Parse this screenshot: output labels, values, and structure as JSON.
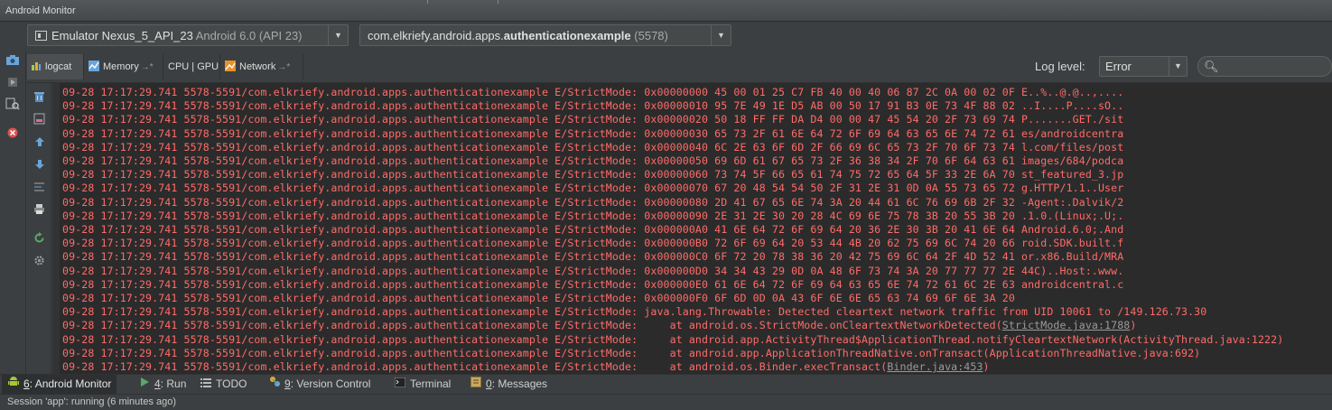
{
  "window": {
    "title": "Android Monitor"
  },
  "devices": {
    "device_name": "Emulator Nexus_5_API_23",
    "device_version": "Android 6.0 (API 23)",
    "process_name": "com.elkriefy.android.apps.",
    "process_bold": "authenticationexample",
    "process_pid": "(5578)"
  },
  "tabs": [
    {
      "label": "logcat"
    },
    {
      "label": "Memory"
    },
    {
      "label": "CPU | GPU"
    },
    {
      "label": "Network"
    }
  ],
  "log_level": {
    "label": "Log level:",
    "value": "Error"
  },
  "log_prefix": "09-28 17:17:29.741 5578-5591/com.elkriefy.android.apps.authenticationexample E/StrictMode: ",
  "log_lines": [
    {
      "text": "0x00000000 45 00 01 25 C7 FB 40 00 40 06 87 2C 0A 00 02 0F E..%..@.@..,....",
      "link": "",
      "tail": ""
    },
    {
      "text": "0x00000010 95 7E 49 1E D5 AB 00 50 17 91 B3 0E 73 4F 88 02 ..I....P....sO..",
      "link": "",
      "tail": ""
    },
    {
      "text": "0x00000020 50 18 FF FF DA D4 00 00 47 45 54 20 2F 73 69 74 P.......GET./sit",
      "link": "",
      "tail": ""
    },
    {
      "text": "0x00000030 65 73 2F 61 6E 64 72 6F 69 64 63 65 6E 74 72 61 es/androidcentra",
      "link": "",
      "tail": ""
    },
    {
      "text": "0x00000040 6C 2E 63 6F 6D 2F 66 69 6C 65 73 2F 70 6F 73 74 l.com/files/post",
      "link": "",
      "tail": ""
    },
    {
      "text": "0x00000050 69 6D 61 67 65 73 2F 36 38 34 2F 70 6F 64 63 61 images/684/podca",
      "link": "",
      "tail": ""
    },
    {
      "text": "0x00000060 73 74 5F 66 65 61 74 75 72 65 64 5F 33 2E 6A 70 st_featured_3.jp",
      "link": "",
      "tail": ""
    },
    {
      "text": "0x00000070 67 20 48 54 54 50 2F 31 2E 31 0D 0A 55 73 65 72 g.HTTP/1.1..User",
      "link": "",
      "tail": ""
    },
    {
      "text": "0x00000080 2D 41 67 65 6E 74 3A 20 44 61 6C 76 69 6B 2F 32 -Agent:.Dalvik/2",
      "link": "",
      "tail": ""
    },
    {
      "text": "0x00000090 2E 31 2E 30 20 28 4C 69 6E 75 78 3B 20 55 3B 20 .1.0.(Linux;.U;.",
      "link": "",
      "tail": ""
    },
    {
      "text": "0x000000A0 41 6E 64 72 6F 69 64 20 36 2E 30 3B 20 41 6E 64 Android.6.0;.And",
      "link": "",
      "tail": ""
    },
    {
      "text": "0x000000B0 72 6F 69 64 20 53 44 4B 20 62 75 69 6C 74 20 66 roid.SDK.built.f",
      "link": "",
      "tail": ""
    },
    {
      "text": "0x000000C0 6F 72 20 78 38 36 20 42 75 69 6C 64 2F 4D 52 41 or.x86.Build/MRA",
      "link": "",
      "tail": ""
    },
    {
      "text": "0x000000D0 34 34 43 29 0D 0A 48 6F 73 74 3A 20 77 77 77 2E 44C)..Host:.www.",
      "link": "",
      "tail": ""
    },
    {
      "text": "0x000000E0 61 6E 64 72 6F 69 64 63 65 6E 74 72 61 6C 2E 63 androidcentral.c",
      "link": "",
      "tail": ""
    },
    {
      "text": "0x000000F0 6F 6D 0D 0A 43 6F 6E 6E 65 63 74 69 6F 6E 3A 20",
      "link": "",
      "tail": ""
    },
    {
      "text": "java.lang.Throwable: Detected cleartext network traffic from UID 10061 to /149.126.73.30",
      "link": "",
      "tail": ""
    },
    {
      "text": "    at android.os.StrictMode.onCleartextNetworkDetected(",
      "link": "StrictMode.java:1788",
      "tail": ")"
    },
    {
      "text": "    at android.app.ActivityThread$ApplicationThread.notifyCleartextNetwork(ActivityThread.java:1222)",
      "link": "",
      "tail": ""
    },
    {
      "text": "    at android.app.ApplicationThreadNative.onTransact(ApplicationThreadNative.java:692)",
      "link": "",
      "tail": ""
    },
    {
      "text": "    at android.os.Binder.execTransact(",
      "link": "Binder.java:453",
      "tail": ")"
    }
  ],
  "bottom_tabs": [
    {
      "num": "6",
      "label": ": Android Monitor"
    },
    {
      "num": "4",
      "label": ": Run"
    },
    {
      "num": "",
      "label": "TODO"
    },
    {
      "num": "9",
      "label": ": Version Control"
    },
    {
      "num": "",
      "label": "Terminal"
    },
    {
      "num": "0",
      "label": ": Messages"
    }
  ],
  "status": {
    "text": "Session 'app': running (6 minutes ago)"
  },
  "colors": {
    "error_text": "#ff6b68",
    "background": "#2b2b2b",
    "panel": "#3c3f41"
  }
}
